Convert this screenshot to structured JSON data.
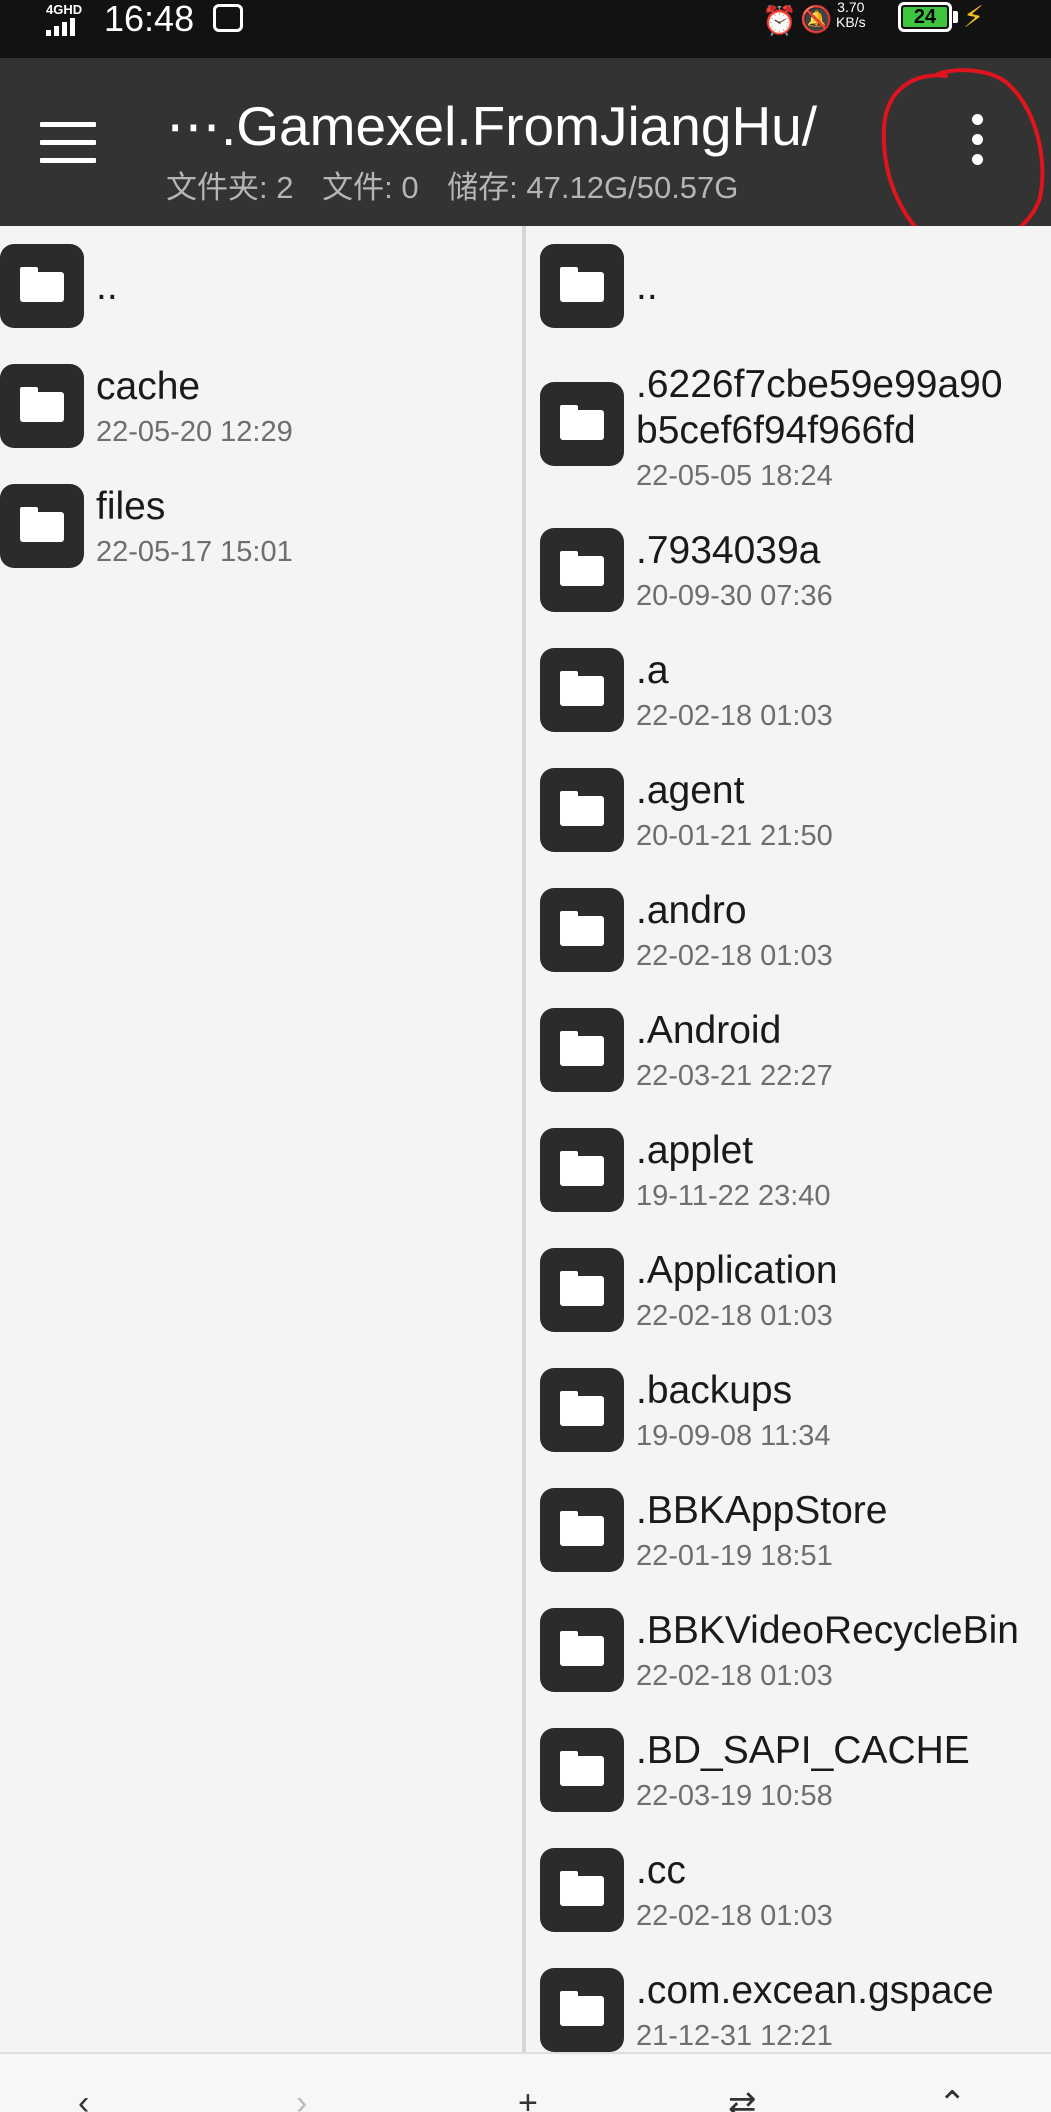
{
  "status_bar": {
    "network": "4GHD",
    "time": "16:48",
    "speed_value": "3.70",
    "speed_unit": "KB/s",
    "battery_level": "24",
    "colors": {
      "battery": "#3fc43f",
      "charging": "#f0c020"
    }
  },
  "app_bar": {
    "path": "⋯.Gamexel.FromJiangHu/",
    "folders": "文件夹: 2",
    "files": "文件: 0",
    "storage": "储存: 47.12G/50.57G",
    "background": "#333333"
  },
  "left_pane": {
    "items": [
      {
        "name": "..",
        "date": ""
      },
      {
        "name": "cache",
        "date": "22-05-20 12:29"
      },
      {
        "name": "files",
        "date": "22-05-17 15:01"
      }
    ]
  },
  "right_pane": {
    "items": [
      {
        "name": "..",
        "date": ""
      },
      {
        "name": ".6226f7cbe59e99a90",
        "name2": "b5cef6f94f966fd",
        "date": "22-05-05 18:24"
      },
      {
        "name": ".7934039a",
        "date": "20-09-30 07:36"
      },
      {
        "name": ".a",
        "date": "22-02-18 01:03"
      },
      {
        "name": ".agent",
        "date": "20-01-21 21:50"
      },
      {
        "name": ".andro",
        "date": "22-02-18 01:03"
      },
      {
        "name": ".Android",
        "date": "22-03-21 22:27"
      },
      {
        "name": ".applet",
        "date": "19-11-22 23:40"
      },
      {
        "name": ".Application",
        "date": "22-02-18 01:03"
      },
      {
        "name": ".backups",
        "date": "19-09-08 11:34"
      },
      {
        "name": ".BBKAppStore",
        "date": "22-01-19 18:51"
      },
      {
        "name": ".BBKVideoRecycleBin",
        "date": "22-02-18 01:03"
      },
      {
        "name": ".BD_SAPI_CACHE",
        "date": "22-03-19 10:58"
      },
      {
        "name": ".cc",
        "date": "22-02-18 01:03"
      },
      {
        "name": ".com.excean.gspace",
        "date": "21-12-31 12:21"
      }
    ]
  },
  "icons": {
    "menu": "hamburger-icon",
    "more": "more-vert-icon",
    "folder": "folder-icon",
    "annotation_color": "#e0141e"
  }
}
